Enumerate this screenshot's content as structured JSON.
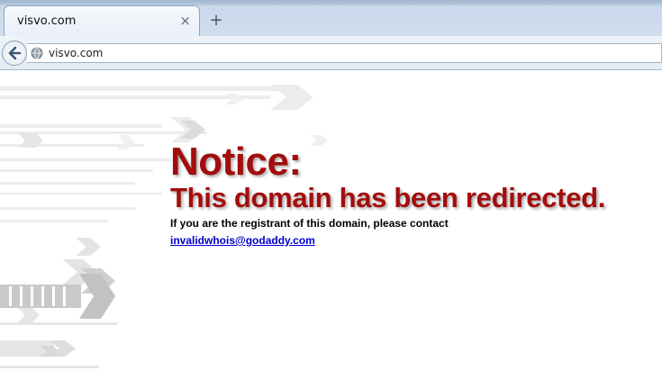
{
  "browser": {
    "tab_title": "visvo.com",
    "tab_close_glyph": "×",
    "new_tab_glyph": "+",
    "url": "visvo.com"
  },
  "page": {
    "heading": "Notice:",
    "subheading": "This domain has been redirected.",
    "body": "If you are the registrant of this domain, please contact",
    "email": "invalidwhois@godaddy.com"
  },
  "colors": {
    "notice_red": "#a30d0d",
    "link_blue": "#0000cc"
  }
}
